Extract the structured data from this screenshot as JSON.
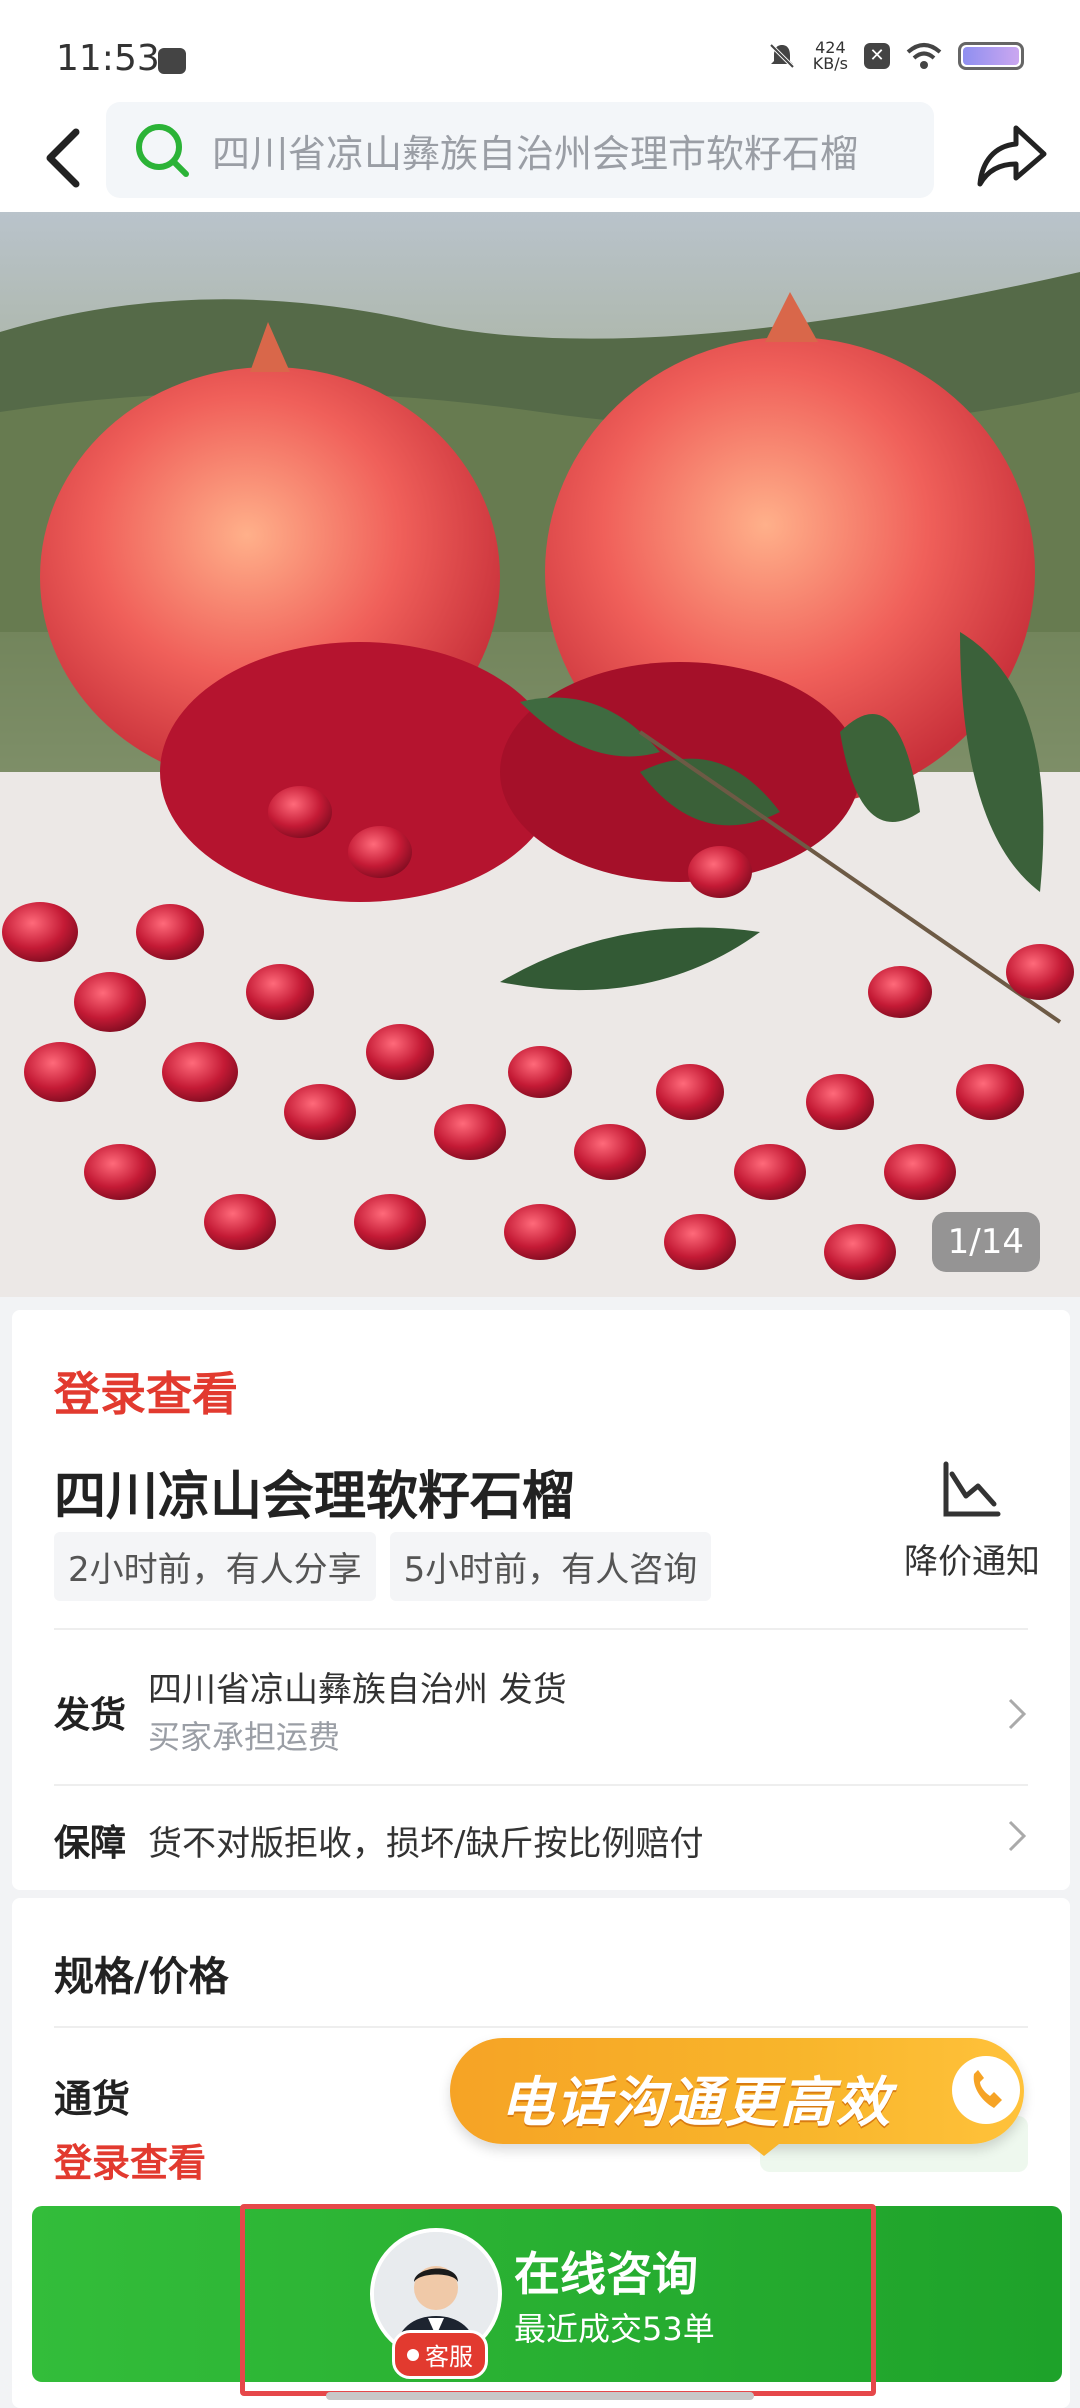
{
  "status_bar": {
    "time": "11:53",
    "net_speed_value": "424",
    "net_speed_unit": "KB/s"
  },
  "nav": {
    "search_text": "四川省凉山彝族自治州会理市软籽石榴",
    "icons": [
      "back-arrow-icon",
      "search-icon",
      "share-icon"
    ]
  },
  "hero": {
    "counter": "1/14"
  },
  "product": {
    "price_text": "登录查看",
    "title": "四川凉山会理软籽石榴",
    "tags": [
      "2小时前，有人分享",
      "5小时前，有人咨询"
    ],
    "price_alert_label": "降价通知"
  },
  "shipping": {
    "label": "发货",
    "origin": "四川省凉山彝族自治州 发货",
    "note": "买家承担运费"
  },
  "guarantee": {
    "label": "保障",
    "text": "货不对版拒收，损坏/缺斤按比例赔付"
  },
  "spec": {
    "title": "规格/价格",
    "variant_name": "通货",
    "variant_price": "登录查看"
  },
  "banner": {
    "text": "电话沟通更高效"
  },
  "bottom": {
    "consult_title": "在线咨询",
    "consult_sub": "最近成交53单",
    "badge": "客服"
  },
  "colors": {
    "accent_red": "#e23a2f",
    "accent_green": "#2bb337",
    "banner_orange": "#f6a325"
  }
}
